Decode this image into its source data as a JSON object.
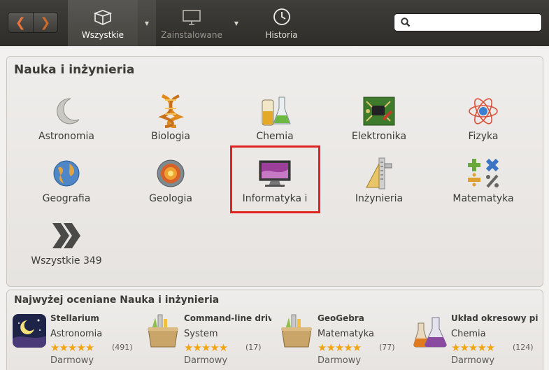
{
  "toolbar": {
    "back": "❮",
    "forward": "❯",
    "all_label": "Wszystkie",
    "installed_label": "Zainstalowane",
    "history_label": "Historia",
    "search_placeholder": ""
  },
  "section": {
    "title": "Nauka i inżynieria",
    "categories": [
      {
        "label": "Astronomia",
        "icon": "moon-icon"
      },
      {
        "label": "Biologia",
        "icon": "dna-icon"
      },
      {
        "label": "Chemia",
        "icon": "beakers-icon"
      },
      {
        "label": "Elektronika",
        "icon": "circuit-board-icon"
      },
      {
        "label": "Fizyka",
        "icon": "atom-icon"
      },
      {
        "label": "Geografia",
        "icon": "globe-icon"
      },
      {
        "label": "Geologia",
        "icon": "earth-layers-icon"
      },
      {
        "label": "Informatyka i",
        "icon": "computer-monitor-icon"
      },
      {
        "label": "Inżynieria",
        "icon": "caliper-icon"
      },
      {
        "label": "Matematyka",
        "icon": "math-operators-icon"
      },
      {
        "label": "Wszystkie 349",
        "icon": "double-chevron-icon"
      }
    ]
  },
  "top_rated": {
    "title": "Najwyżej oceniane Nauka i inżynieria",
    "apps": [
      {
        "name": "Stellarium",
        "category": "Astronomia",
        "stars": "★★★★★",
        "count": "(491)",
        "price": "Darmowy"
      },
      {
        "name": "Command-line driv...",
        "category": "System",
        "stars": "★★★★★",
        "count": "(17)",
        "price": "Darmowy"
      },
      {
        "name": "GeoGebra",
        "category": "Matematyka",
        "stars": "★★★★★",
        "count": "(77)",
        "price": "Darmowy"
      },
      {
        "name": "Układ okresowy pi...",
        "category": "Chemia",
        "stars": "★★★★★",
        "count": "(124)",
        "price": "Darmowy"
      }
    ]
  }
}
